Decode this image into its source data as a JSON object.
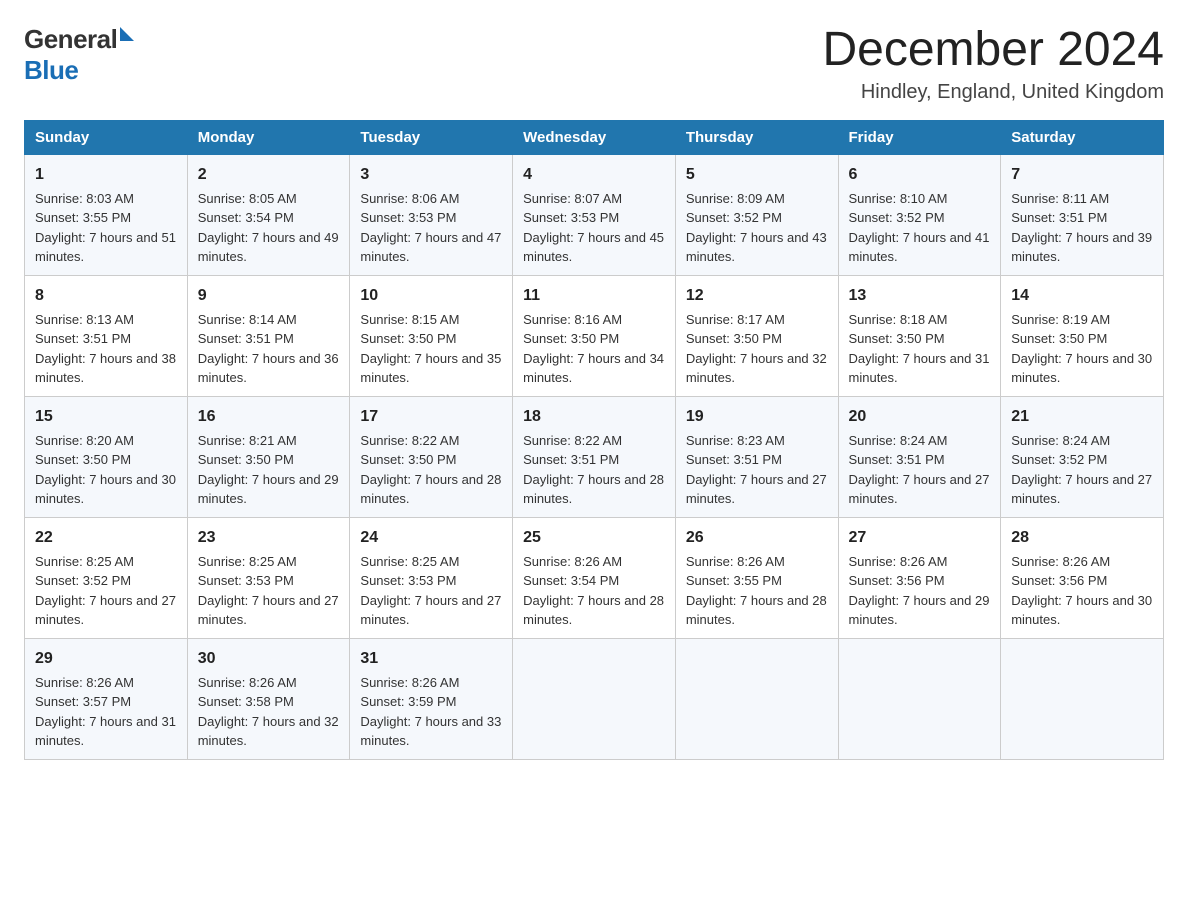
{
  "logo": {
    "text1": "General",
    "text2": "Blue"
  },
  "header": {
    "month": "December 2024",
    "location": "Hindley, England, United Kingdom"
  },
  "days_header": [
    "Sunday",
    "Monday",
    "Tuesday",
    "Wednesday",
    "Thursday",
    "Friday",
    "Saturday"
  ],
  "weeks": [
    [
      {
        "day": "1",
        "sunrise": "8:03 AM",
        "sunset": "3:55 PM",
        "daylight": "7 hours and 51 minutes."
      },
      {
        "day": "2",
        "sunrise": "8:05 AM",
        "sunset": "3:54 PM",
        "daylight": "7 hours and 49 minutes."
      },
      {
        "day": "3",
        "sunrise": "8:06 AM",
        "sunset": "3:53 PM",
        "daylight": "7 hours and 47 minutes."
      },
      {
        "day": "4",
        "sunrise": "8:07 AM",
        "sunset": "3:53 PM",
        "daylight": "7 hours and 45 minutes."
      },
      {
        "day": "5",
        "sunrise": "8:09 AM",
        "sunset": "3:52 PM",
        "daylight": "7 hours and 43 minutes."
      },
      {
        "day": "6",
        "sunrise": "8:10 AM",
        "sunset": "3:52 PM",
        "daylight": "7 hours and 41 minutes."
      },
      {
        "day": "7",
        "sunrise": "8:11 AM",
        "sunset": "3:51 PM",
        "daylight": "7 hours and 39 minutes."
      }
    ],
    [
      {
        "day": "8",
        "sunrise": "8:13 AM",
        "sunset": "3:51 PM",
        "daylight": "7 hours and 38 minutes."
      },
      {
        "day": "9",
        "sunrise": "8:14 AM",
        "sunset": "3:51 PM",
        "daylight": "7 hours and 36 minutes."
      },
      {
        "day": "10",
        "sunrise": "8:15 AM",
        "sunset": "3:50 PM",
        "daylight": "7 hours and 35 minutes."
      },
      {
        "day": "11",
        "sunrise": "8:16 AM",
        "sunset": "3:50 PM",
        "daylight": "7 hours and 34 minutes."
      },
      {
        "day": "12",
        "sunrise": "8:17 AM",
        "sunset": "3:50 PM",
        "daylight": "7 hours and 32 minutes."
      },
      {
        "day": "13",
        "sunrise": "8:18 AM",
        "sunset": "3:50 PM",
        "daylight": "7 hours and 31 minutes."
      },
      {
        "day": "14",
        "sunrise": "8:19 AM",
        "sunset": "3:50 PM",
        "daylight": "7 hours and 30 minutes."
      }
    ],
    [
      {
        "day": "15",
        "sunrise": "8:20 AM",
        "sunset": "3:50 PM",
        "daylight": "7 hours and 30 minutes."
      },
      {
        "day": "16",
        "sunrise": "8:21 AM",
        "sunset": "3:50 PM",
        "daylight": "7 hours and 29 minutes."
      },
      {
        "day": "17",
        "sunrise": "8:22 AM",
        "sunset": "3:50 PM",
        "daylight": "7 hours and 28 minutes."
      },
      {
        "day": "18",
        "sunrise": "8:22 AM",
        "sunset": "3:51 PM",
        "daylight": "7 hours and 28 minutes."
      },
      {
        "day": "19",
        "sunrise": "8:23 AM",
        "sunset": "3:51 PM",
        "daylight": "7 hours and 27 minutes."
      },
      {
        "day": "20",
        "sunrise": "8:24 AM",
        "sunset": "3:51 PM",
        "daylight": "7 hours and 27 minutes."
      },
      {
        "day": "21",
        "sunrise": "8:24 AM",
        "sunset": "3:52 PM",
        "daylight": "7 hours and 27 minutes."
      }
    ],
    [
      {
        "day": "22",
        "sunrise": "8:25 AM",
        "sunset": "3:52 PM",
        "daylight": "7 hours and 27 minutes."
      },
      {
        "day": "23",
        "sunrise": "8:25 AM",
        "sunset": "3:53 PM",
        "daylight": "7 hours and 27 minutes."
      },
      {
        "day": "24",
        "sunrise": "8:25 AM",
        "sunset": "3:53 PM",
        "daylight": "7 hours and 27 minutes."
      },
      {
        "day": "25",
        "sunrise": "8:26 AM",
        "sunset": "3:54 PM",
        "daylight": "7 hours and 28 minutes."
      },
      {
        "day": "26",
        "sunrise": "8:26 AM",
        "sunset": "3:55 PM",
        "daylight": "7 hours and 28 minutes."
      },
      {
        "day": "27",
        "sunrise": "8:26 AM",
        "sunset": "3:56 PM",
        "daylight": "7 hours and 29 minutes."
      },
      {
        "day": "28",
        "sunrise": "8:26 AM",
        "sunset": "3:56 PM",
        "daylight": "7 hours and 30 minutes."
      }
    ],
    [
      {
        "day": "29",
        "sunrise": "8:26 AM",
        "sunset": "3:57 PM",
        "daylight": "7 hours and 31 minutes."
      },
      {
        "day": "30",
        "sunrise": "8:26 AM",
        "sunset": "3:58 PM",
        "daylight": "7 hours and 32 minutes."
      },
      {
        "day": "31",
        "sunrise": "8:26 AM",
        "sunset": "3:59 PM",
        "daylight": "7 hours and 33 minutes."
      },
      null,
      null,
      null,
      null
    ]
  ]
}
